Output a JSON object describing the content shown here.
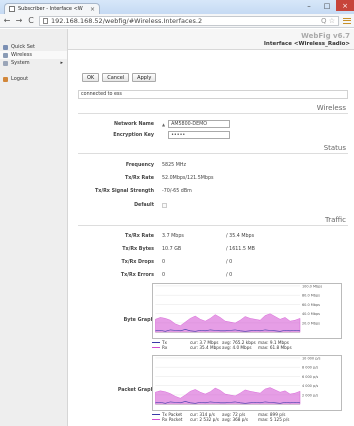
{
  "browser": {
    "tab_title": "Subscriber - Interface <W",
    "url": "192.168.168.52/webfig/#Wireless.Interfaces.2"
  },
  "header": {
    "brand": "WebFig v6.7",
    "interface_title": "Interface <Wireless_Radio>"
  },
  "sidebar": {
    "items": [
      {
        "label": "Quick Set",
        "icon": "quickset-icon",
        "color": "#7b8fb3"
      },
      {
        "label": "Wireless",
        "icon": "wireless-icon",
        "color": "#8a9bb5"
      },
      {
        "label": "System",
        "icon": "system-icon",
        "color": "#9aa5b8",
        "has_arrow": true
      },
      {
        "label": "Logout",
        "icon": "logout-icon",
        "color": "#d2873a"
      }
    ]
  },
  "toolbar": {
    "ok": "OK",
    "cancel": "Cancel",
    "apply": "Apply"
  },
  "status_text": "connected to ess",
  "sections": {
    "wireless": "Wireless",
    "status": "Status",
    "traffic": "Traffic"
  },
  "wireless": {
    "network_name_label": "Network Name",
    "network_name_value": "AM5800-DEMO",
    "encryption_label": "Encryption Key",
    "encryption_value": "•••••"
  },
  "status": {
    "frequency_label": "Frequency",
    "frequency_value": "5825 MHz",
    "txrx_rate_label": "Tx/Rx Rate",
    "txrx_rate_value": "52.0Mbps/121.5Mbps",
    "signal_label": "Tx/Rx Signal Strength",
    "signal_value": "-70/-65 dBm",
    "default_label": "Default"
  },
  "traffic": {
    "rows": [
      {
        "label": "Tx/Rx Rate",
        "tx": "3.7 Mbps",
        "rx": "/ 35.4 Mbps"
      },
      {
        "label": "Tx/Rx Bytes",
        "tx": "10.7 GB",
        "rx": "/ 1611.5 MB"
      },
      {
        "label": "Tx/Rx Drops",
        "tx": "0",
        "rx": "/ 0"
      },
      {
        "label": "Tx/Rx Errors",
        "tx": "0",
        "rx": "/ 0"
      }
    ],
    "byte_graph_label": "Byte Graph",
    "packet_graph_label": "Packet Graph"
  },
  "byte_graph": {
    "y_ticks": [
      "100.0 Mbps",
      "80.0 Mbps",
      "60.0 Mbps",
      "40.0 Mbps",
      "20.0 Mbps"
    ],
    "ymax": 100,
    "tx_color": "#3a3aa8",
    "rx_color": "#d14fd1",
    "tx_values": [
      3,
      4,
      2,
      5,
      4,
      3,
      6,
      3,
      2,
      4,
      3,
      5,
      4,
      3,
      3,
      4,
      5,
      3,
      2,
      3,
      4,
      3,
      5,
      4,
      3,
      2,
      4,
      3,
      4,
      3
    ],
    "rx_values": [
      28,
      32,
      30,
      26,
      18,
      14,
      22,
      30,
      35,
      28,
      24,
      30,
      38,
      32,
      24,
      22,
      20,
      26,
      34,
      30,
      28,
      26,
      36,
      40,
      34,
      28,
      32,
      24,
      26,
      30
    ],
    "legend": [
      {
        "name": "Tx",
        "cur": "cur: 3.7 Mbps",
        "avg": "avg: 765.2 kbps",
        "max": "max: 9.1 Mbps"
      },
      {
        "name": "Rx",
        "cur": "cur: 35.4 Mbps",
        "avg": "avg: 4.0 Mbps",
        "max": "max: 61.8 Mbps"
      }
    ]
  },
  "packet_graph": {
    "y_ticks": [
      "10 000 p/s",
      "8 000 p/s",
      "6 000 p/s",
      "4 000 p/s",
      "2 000 p/s"
    ],
    "ymax": 10000,
    "tx_color": "#3a3aa8",
    "rx_color": "#d14fd1",
    "tx_values": [
      300,
      400,
      200,
      500,
      400,
      300,
      600,
      300,
      200,
      400,
      300,
      500,
      400,
      300,
      300,
      400,
      500,
      300,
      200,
      300,
      400,
      300,
      500,
      400,
      300,
      200,
      400,
      300,
      400,
      300
    ],
    "rx_values": [
      2600,
      2900,
      2700,
      2300,
      1700,
      1300,
      2000,
      2800,
      3200,
      2600,
      2200,
      2700,
      3500,
      3000,
      2200,
      2000,
      1800,
      2400,
      3100,
      2800,
      2600,
      2400,
      3300,
      3600,
      3100,
      2600,
      2900,
      2200,
      2400,
      2800
    ],
    "legend": [
      {
        "name": "Tx Packet",
        "cur": "cur: 314 p/s",
        "avg": "avg: 72 p/s",
        "max": "max: 899 p/s"
      },
      {
        "name": "Rx Packet",
        "cur": "cur: 2 532 p/s",
        "avg": "avg: 368 p/s",
        "max": "max: 5 125 p/s"
      }
    ]
  }
}
